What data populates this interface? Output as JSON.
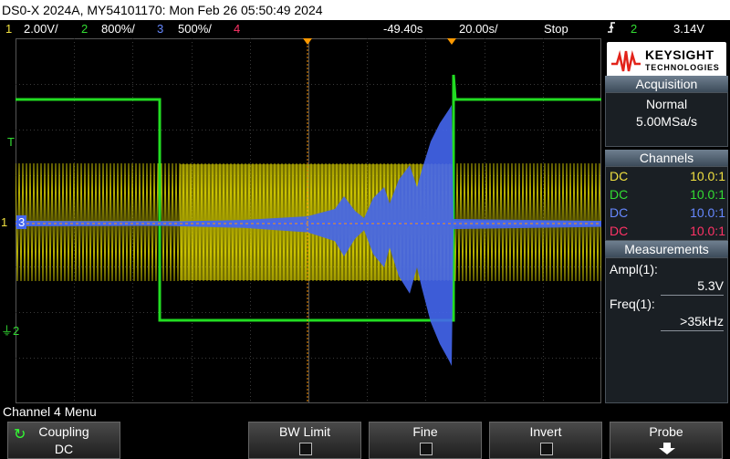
{
  "title": "DS0-X 2024A, MY54101170: Mon Feb 26 05:50:49 2024",
  "status": {
    "ch1": {
      "num": "1",
      "scale": "2.00V/",
      "color": "#f0e040"
    },
    "ch2": {
      "num": "2",
      "scale": "800%/",
      "color": "#33dd33"
    },
    "ch3": {
      "num": "3",
      "scale": "500%/",
      "color": "#5577ff"
    },
    "ch4": {
      "num": "4",
      "color": "#ff3366"
    },
    "time_offset": "-49.40s",
    "time_scale": "20.00s/",
    "run_state": "Stop",
    "trigger_icon": "edge-trigger-icon",
    "trigger_channel": "2",
    "trigger_level": "3.14V"
  },
  "logo": {
    "line1": "KEYSIGHT",
    "line2": "TECHNOLOGIES"
  },
  "acquisition": {
    "header": "Acquisition",
    "mode": "Normal",
    "rate": "5.00MSa/s"
  },
  "channels": {
    "header": "Channels",
    "rows": [
      {
        "coupling": "DC",
        "probe": "10.0:1",
        "color": "#f0e040"
      },
      {
        "coupling": "DC",
        "probe": "10.0:1",
        "color": "#33dd33"
      },
      {
        "coupling": "DC",
        "probe": "10.0:1",
        "color": "#6688ff"
      },
      {
        "coupling": "DC",
        "probe": "10.0:1",
        "color": "#ff3366"
      }
    ]
  },
  "measurements": {
    "header": "Measurements",
    "items": [
      {
        "label": "Ampl(1):",
        "value": "5.3V"
      },
      {
        "label": "Freq(1):",
        "value": ">35kHz"
      }
    ]
  },
  "markers": {
    "trigger": "T",
    "ch1": "1",
    "ch3": "3",
    "ch2": "2"
  },
  "menu_title": "Channel 4 Menu",
  "softkeys": [
    {
      "label": "Coupling",
      "value": "DC",
      "icon": "rotate-knob-icon"
    },
    {
      "label": "BW Limit"
    },
    {
      "label": "Fine"
    },
    {
      "label": "Invert"
    },
    {
      "label": "Probe",
      "icon": "down-arrow-icon"
    }
  ],
  "colors": {
    "ch1": "#d8d000",
    "ch2": "#22dd22",
    "ch3": "#4466ee",
    "trigger_marker": "#ff9900"
  }
}
